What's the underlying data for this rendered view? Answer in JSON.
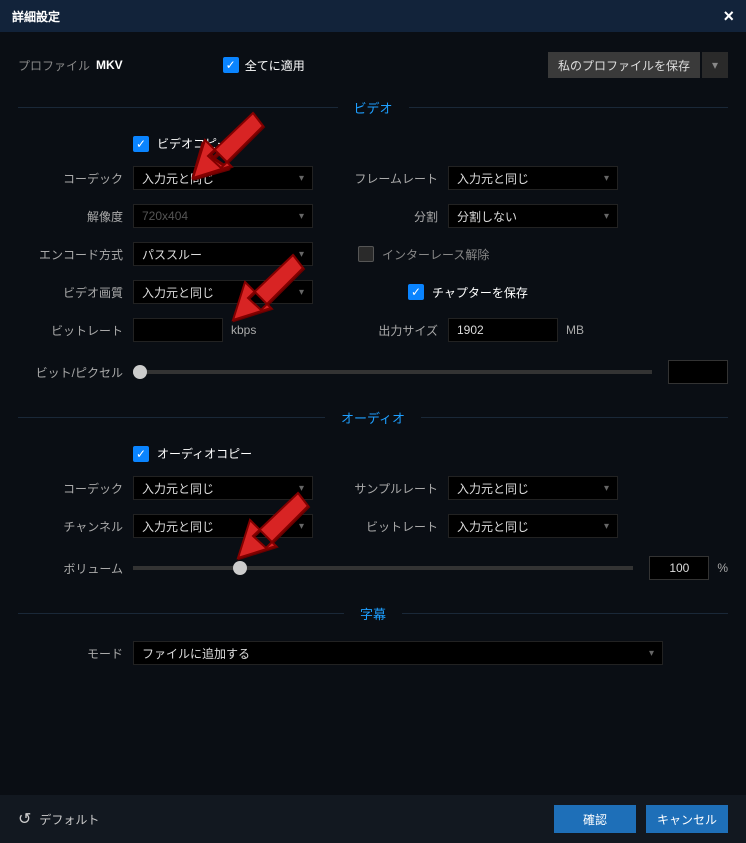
{
  "titlebar": {
    "title": "詳細設定"
  },
  "profile": {
    "label": "プロファイル",
    "name": "MKV"
  },
  "apply_all": {
    "label": "全てに適用"
  },
  "save_profile": {
    "label": "私のプロファイルを保存"
  },
  "sections": {
    "video": "ビデオ",
    "audio": "オーディオ",
    "subtitle": "字幕"
  },
  "video": {
    "copy_label": "ビデオコピー",
    "codec_label": "コーデック",
    "codec_value": "入力元と同じ",
    "resolution_label": "解像度",
    "resolution_value": "720x404",
    "encode_label": "エンコード方式",
    "encode_value": "パススルー",
    "quality_label": "ビデオ画質",
    "quality_value": "入力元と同じ",
    "bitrate_label": "ビットレート",
    "bitrate_value": "",
    "bitrate_unit": "kbps",
    "framerate_label": "フレームレート",
    "framerate_value": "入力元と同じ",
    "split_label": "分割",
    "split_value": "分割しない",
    "interlace_label": "インターレース解除",
    "chapter_label": "チャプターを保存",
    "outsize_label": "出力サイズ",
    "outsize_value": "1902",
    "outsize_unit": "MB",
    "bpp_label": "ビット/ピクセル",
    "bpp_value": ""
  },
  "audio": {
    "copy_label": "オーディオコピー",
    "codec_label": "コーデック",
    "codec_value": "入力元と同じ",
    "channel_label": "チャンネル",
    "channel_value": "入力元と同じ",
    "samplerate_label": "サンプルレート",
    "samplerate_value": "入力元と同じ",
    "bitrate_label": "ビットレート",
    "bitrate_value": "入力元と同じ",
    "volume_label": "ボリューム",
    "volume_value": "100",
    "volume_unit": "%"
  },
  "subtitle": {
    "mode_label": "モード",
    "mode_value": "ファイルに追加する"
  },
  "footer": {
    "default": "デフォルト",
    "ok": "確認",
    "cancel": "キャンセル"
  }
}
